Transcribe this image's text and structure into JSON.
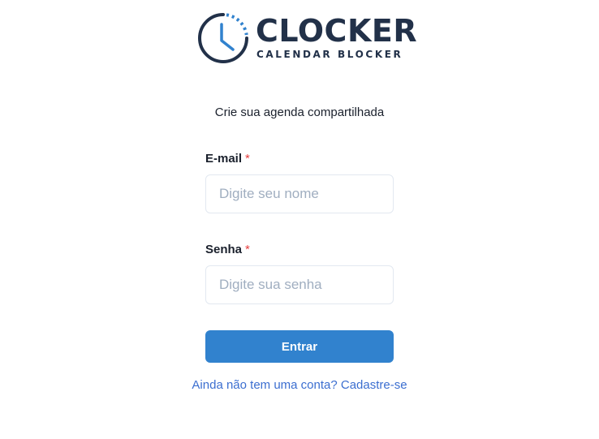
{
  "logo": {
    "title": "CLOCKER",
    "subtitle": "CALENDAR BLOCKER",
    "icon": "clock-icon"
  },
  "tagline": "Crie sua agenda compartilhada",
  "form": {
    "email": {
      "label": "E-mail",
      "required_mark": "*",
      "placeholder": "Digite seu nome",
      "value": ""
    },
    "password": {
      "label": "Senha",
      "required_mark": "*",
      "placeholder": "Digite sua senha",
      "value": ""
    },
    "submit_label": "Entrar"
  },
  "signup_link": "Ainda não tem uma conta? Cadastre-se",
  "colors": {
    "brand": "#223149",
    "accent": "#3182ce",
    "required": "#e53e3e",
    "link": "#3b6ed0"
  }
}
